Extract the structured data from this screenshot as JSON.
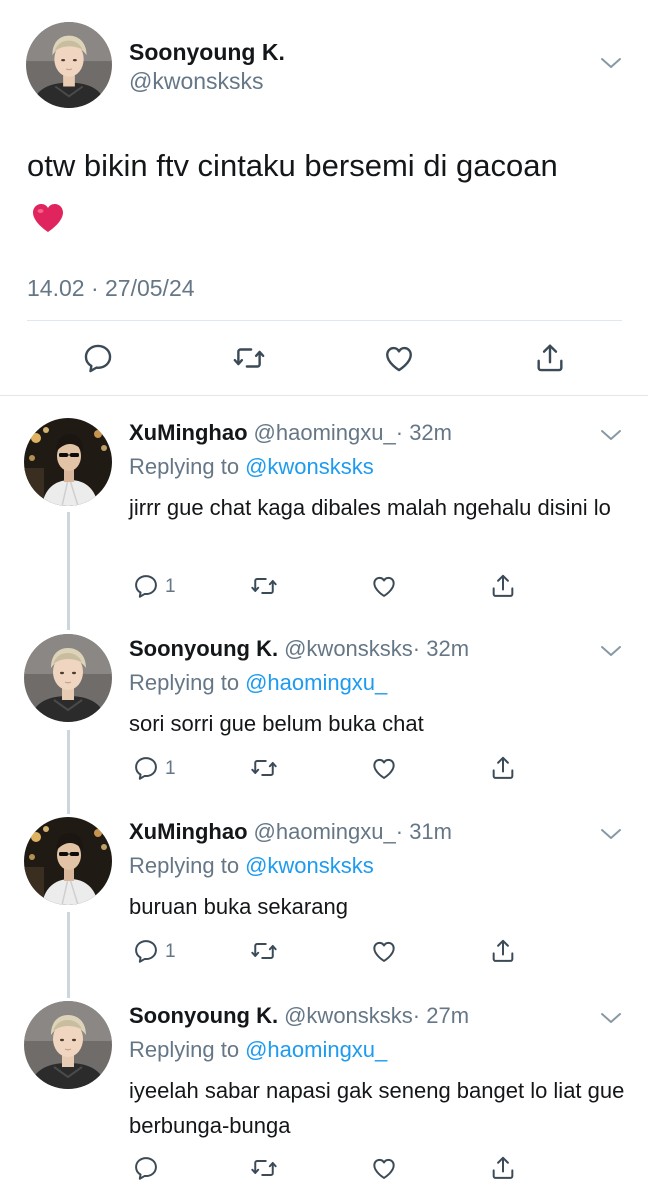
{
  "main_tweet": {
    "author_name": "Soonyoung K.",
    "author_handle": "@kwonsksks",
    "text": "otw bikin ftv cintaku bersemi di gacoan",
    "emoji": "red-heart",
    "timestamp": "14.02 · 27/05/24",
    "actions": [
      "reply-icon",
      "retweet-icon",
      "like-icon",
      "share-icon"
    ]
  },
  "replies": [
    {
      "author_name": "XuMinghao",
      "author_handle": "@haomingxu_",
      "age": "· 32m",
      "replying_label": "Replying to",
      "replying_to": "@kwonsksks",
      "text": "jirrr gue chat kaga dibales malah ngehalu disini lo",
      "reply_count": "1"
    },
    {
      "author_name": "Soonyoung K.",
      "author_handle": "@kwonsksks",
      "age": "· 32m",
      "replying_label": "Replying to",
      "replying_to": "@haomingxu_",
      "text": "sori sorri gue belum buka chat",
      "reply_count": "1"
    },
    {
      "author_name": "XuMinghao",
      "author_handle": "@haomingxu_",
      "age": "· 31m",
      "replying_label": "Replying to",
      "replying_to": "@kwonsksks",
      "text": "buruan buka sekarang",
      "reply_count": "1"
    },
    {
      "author_name": "Soonyoung K.",
      "author_handle": "@kwonsksks",
      "age": "· 27m",
      "replying_label": "Replying to",
      "replying_to": "@haomingxu_",
      "text": "iyeelah sabar napasi gak seneng banget lo liat gue berbunga-bunga",
      "reply_count": ""
    }
  ],
  "colors": {
    "text": "#14171a",
    "secondary": "#657786",
    "link": "#1d9bf0",
    "divider": "#e1e8ed",
    "thread_line": "#ccd6dd",
    "heart": "#e0245e"
  }
}
